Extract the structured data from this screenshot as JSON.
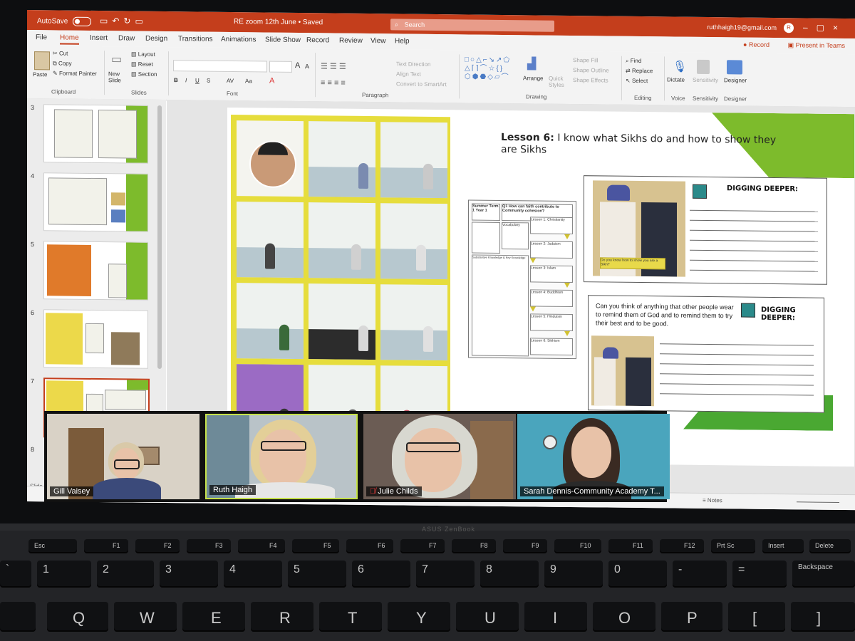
{
  "titlebar": {
    "autosave_label": "AutoSave",
    "toggle_state": "On",
    "doc_title": "RE zoom 12th June",
    "saved_status": "• Saved",
    "search_placeholder": "Search",
    "account_email": "ruthhaigh19@gmail.com",
    "account_initial": "R"
  },
  "menu": {
    "tabs": [
      "File",
      "Home",
      "Insert",
      "Draw",
      "Design",
      "Transitions",
      "Animations",
      "Slide Show",
      "Record",
      "Review",
      "View",
      "Help"
    ],
    "active_tab": "Home",
    "record_label": "Record",
    "present_teams_label": "Present in Teams"
  },
  "ribbon": {
    "clipboard": {
      "paste": "Paste",
      "cut": "Cut",
      "copy": "Copy",
      "format_painter": "Format Painter",
      "label": "Clipboard"
    },
    "slides": {
      "new_slide": "New Slide",
      "layout": "Layout",
      "reset": "Reset",
      "section": "Section",
      "label": "Slides"
    },
    "font": {
      "label": "Font",
      "bold": "B",
      "italic": "I",
      "underline": "U",
      "strike": "S",
      "spacing": "AV",
      "case": "Aa",
      "grow": "A",
      "shrink": "A"
    },
    "paragraph": {
      "label": "Paragraph",
      "text_direction": "Text Direction",
      "align_text": "Align Text",
      "convert_smartart": "Convert to SmartArt"
    },
    "drawing": {
      "label": "Drawing",
      "arrange": "Arrange",
      "quick_styles": "Quick Styles",
      "shape_fill": "Shape Fill",
      "shape_outline": "Shape Outline",
      "shape_effects": "Shape Effects"
    },
    "editing": {
      "label": "Editing",
      "find": "Find",
      "replace": "Replace",
      "select": "Select"
    },
    "voice": {
      "label": "Voice",
      "dictate": "Dictate"
    },
    "sensitivity": {
      "label": "Sensitivity",
      "button": "Sensitivity"
    },
    "designer": {
      "label": "Designer",
      "button": "Designer"
    }
  },
  "slide_panel": {
    "thumbnails": [
      "3",
      "4",
      "5",
      "6",
      "7",
      "8"
    ],
    "selected": "7"
  },
  "slide": {
    "lesson_number": "Lesson 6:",
    "lesson_text": "I know what Sikhs do and how to show they are Sikhs",
    "organiser": {
      "box1": "Summer Term 1 Year 1",
      "box2": "Q1 How can faith contribute to Community cohesion?",
      "box3": "Vocabulary",
      "box4": "Lesson 1: Christianity",
      "box5": "Lesson 2: Judaism",
      "box6": "Lesson 3: Islam",
      "box7": "Lesson 4: Buddhism",
      "box8": "Lesson 5: Hinduism",
      "box9": "Lesson 6: Sikhism",
      "notes": "Substantive Knowledge & Key Knowledge"
    },
    "digging_deeper_1": {
      "title": "DIGGING DEEPER:",
      "caption": "Do you know how to show you are a Sikh?"
    },
    "digging_deeper_2": {
      "title": "DIGGING DEEPER:",
      "question": "Can you think of anything that other people wear to remind them of God and to remind them to try their best and to be good."
    }
  },
  "statusbar": {
    "slide_info": "Slide 7",
    "notes": "Notes"
  },
  "participants": [
    {
      "name": "Gill Vaisey",
      "muted": false,
      "active": false
    },
    {
      "name": "Ruth Haigh",
      "muted": false,
      "active": true
    },
    {
      "name": "Julie Childs",
      "muted": true,
      "active": false
    },
    {
      "name": "Sarah Dennis-Community Academy T...",
      "muted": false,
      "active": false
    }
  ],
  "keyboard": {
    "brand": "ASUS ZenBook",
    "fn_row": [
      "Esc",
      "F1",
      "F2",
      "F3",
      "F4",
      "F5",
      "F6",
      "F7",
      "F8",
      "F9",
      "F10",
      "F11",
      "F12",
      "Prt Sc",
      "Insert",
      "Delete"
    ],
    "num_row": [
      "`",
      "1",
      "2",
      "3",
      "4",
      "5",
      "6",
      "7",
      "8",
      "9",
      "0",
      "-",
      "=",
      "Backspace"
    ],
    "alpha_row": [
      "Q",
      "W",
      "E",
      "R",
      "T",
      "Y",
      "U",
      "I",
      "O",
      "P",
      "[",
      "]"
    ]
  }
}
